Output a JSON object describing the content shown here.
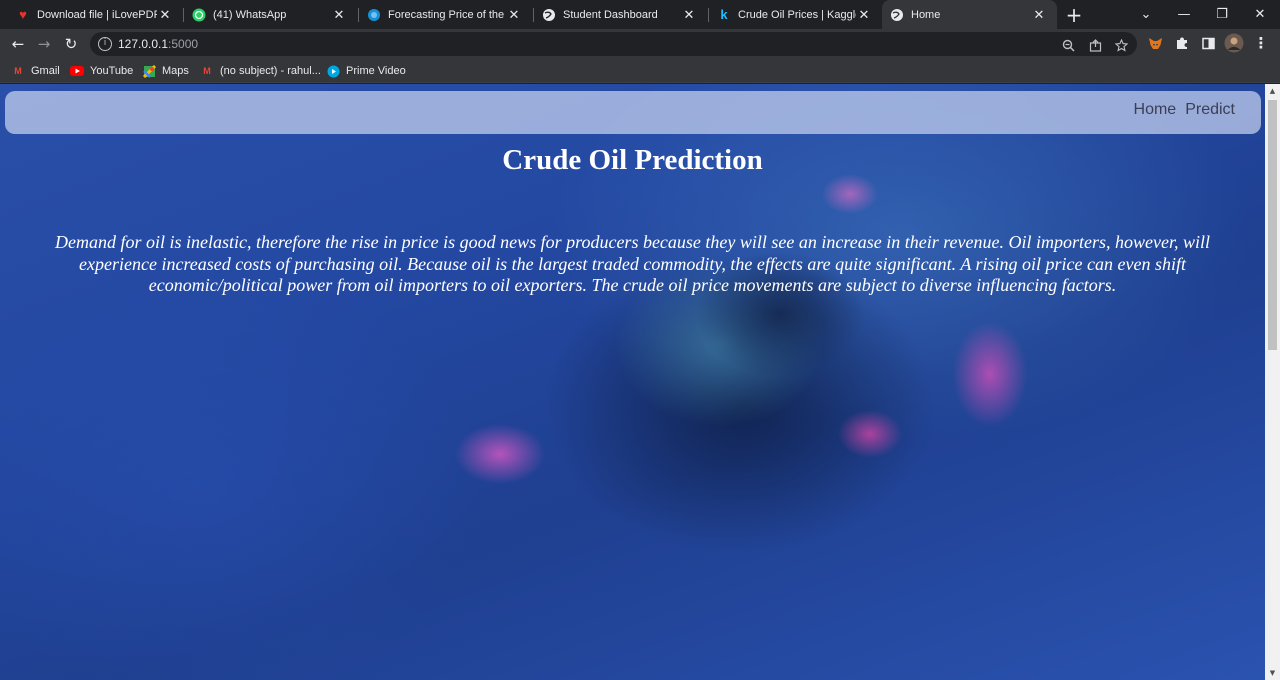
{
  "browser": {
    "tabs": [
      {
        "title": "Download file | iLovePDF",
        "icon": "ilovepdf-heart-icon",
        "color": "#e5322d"
      },
      {
        "title": "(41) WhatsApp",
        "icon": "whatsapp-icon",
        "color": "#25d366"
      },
      {
        "title": "Forecasting Price of the Cru",
        "icon": "blue-globe-icon",
        "color": "#1a8fd6"
      },
      {
        "title": "Student Dashboard",
        "icon": "globe-icon",
        "color": "#e8eaed"
      },
      {
        "title": "Crude Oil Prices | Kaggle",
        "icon": "kaggle-k-icon",
        "color": "#20beff"
      },
      {
        "title": "Home",
        "icon": "globe-icon",
        "color": "#e8eaed",
        "active": true
      }
    ],
    "close_glyph": "✕",
    "newtab_glyph": "+",
    "window_controls": {
      "dropdown": "⌄",
      "minimize": "—",
      "restore": "❐",
      "close": "✕"
    },
    "nav": {
      "back": "←",
      "forward": "→",
      "reload": "↻"
    },
    "address": {
      "host": "127.0.0.1",
      "port": ":5000"
    },
    "bookmarks": [
      {
        "label": "Gmail",
        "icon": "gmail-icon",
        "glyph": "M",
        "color": "#ea4335"
      },
      {
        "label": "YouTube",
        "icon": "youtube-icon",
        "glyph": "▶",
        "color": "#ff0000"
      },
      {
        "label": "Maps",
        "icon": "maps-icon",
        "glyph": "◆",
        "color": "#34a853"
      },
      {
        "label": "(no subject) - rahul...",
        "icon": "gmail-icon",
        "glyph": "M",
        "color": "#ea4335"
      },
      {
        "label": "Prime Video",
        "icon": "prime-video-icon",
        "glyph": "▶",
        "color": "#00a8e1"
      }
    ]
  },
  "site": {
    "nav": {
      "home": "Home",
      "predict": "Predict"
    },
    "title": "Crude Oil Prediction",
    "description": "Demand for oil is inelastic, therefore the rise in price is good news for producers because they will see an increase in their revenue. Oil importers, however, will experience increased costs of purchasing oil. Because oil is the largest traded commodity, the effects are quite significant. A rising oil price can even shift economic/political power from oil importers to oil exporters. The crude oil price movements are subject to diverse influencing factors."
  }
}
